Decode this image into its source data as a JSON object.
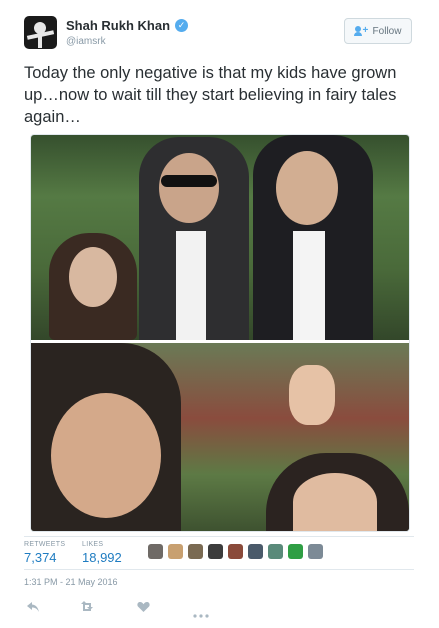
{
  "user": {
    "name": "Shah Rukh Khan",
    "handle": "@iamsrk"
  },
  "follow_button": {
    "label": "Follow"
  },
  "tweet": {
    "text": "Today the only negative is that my kids have grown up…now to wait till they start believing in fairy tales again…"
  },
  "stats": {
    "retweets_label": "RETWEETS",
    "retweets_value": "7,374",
    "likes_label": "LIKES",
    "likes_value": "18,992"
  },
  "timestamp": "1:31 PM - 21 May 2016",
  "actions": {
    "reply_icon": "reply-icon",
    "retweet_icon": "retweet-icon",
    "like_icon": "heart-icon",
    "more_icon": "more-icon"
  },
  "colors": {
    "accent": "#55acee",
    "link": "#1f7cc1",
    "muted": "#8899a6"
  }
}
